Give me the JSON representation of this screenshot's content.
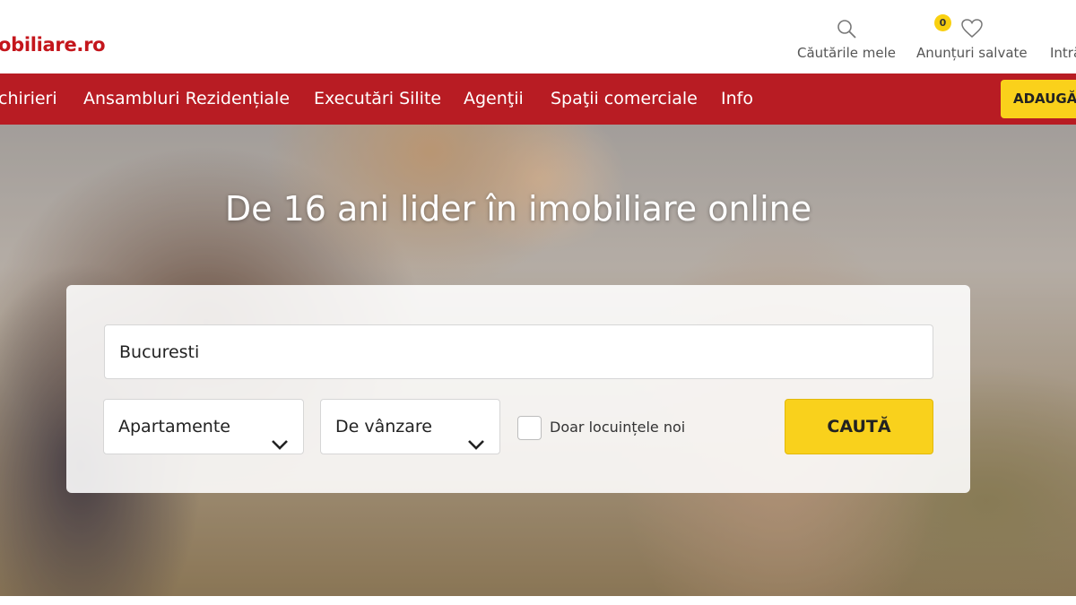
{
  "brand": {
    "logo_text": "obiliare.ro",
    "accent": "#b81c23",
    "cta_yellow": "#f9d11c"
  },
  "header": {
    "saved_searches": {
      "label": "Căutările mele",
      "icon": "search-icon"
    },
    "saved_ads": {
      "label": "Anunțuri salvate",
      "icon": "heart-icon",
      "badge": "0"
    },
    "login": {
      "label": "Intră"
    }
  },
  "nav": {
    "items": [
      "chirieri",
      "Ansambluri Rezidențiale",
      "Executări Silite",
      "Agenţii",
      "Spaţii comerciale",
      "Info"
    ],
    "add_button": "ADAUGĂ"
  },
  "hero": {
    "title": "De 16 ani lider în imobiliare online"
  },
  "search": {
    "location_value": "Bucuresti",
    "property_type": "Apartamente",
    "transaction_type": "De vânzare",
    "new_only_label": "Doar locuințele noi",
    "new_only_checked": false,
    "submit_label": "CAUTĂ"
  }
}
